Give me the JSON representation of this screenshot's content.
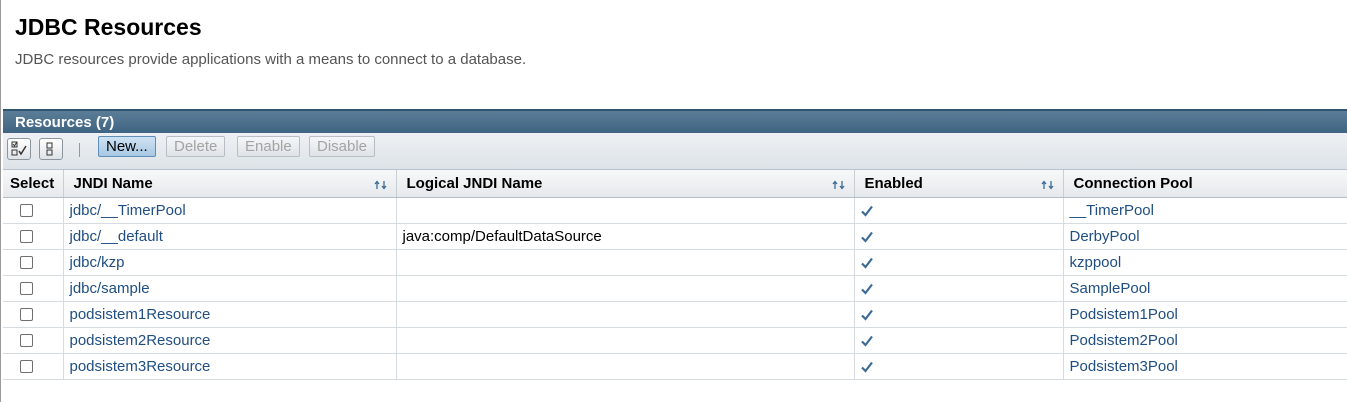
{
  "page": {
    "title": "JDBC Resources",
    "help_text": "JDBC resources provide applications with a means to connect to a database."
  },
  "table": {
    "title": "Resources (7)",
    "buttons": {
      "new": "New...",
      "delete": "Delete",
      "enable": "Enable",
      "disable": "Disable"
    },
    "columns": [
      "Select",
      "JNDI Name",
      "Logical JNDI Name",
      "Enabled",
      "Connection Pool"
    ],
    "rows": [
      {
        "jndi_name": "jdbc/__TimerPool",
        "logical_jndi_name": "",
        "enabled": true,
        "connection_pool": "__TimerPool"
      },
      {
        "jndi_name": "jdbc/__default",
        "logical_jndi_name": "java:comp/DefaultDataSource",
        "enabled": true,
        "connection_pool": "DerbyPool"
      },
      {
        "jndi_name": "jdbc/kzp",
        "logical_jndi_name": "",
        "enabled": true,
        "connection_pool": "kzppool"
      },
      {
        "jndi_name": "jdbc/sample",
        "logical_jndi_name": "",
        "enabled": true,
        "connection_pool": "SamplePool"
      },
      {
        "jndi_name": "podsistem1Resource",
        "logical_jndi_name": "",
        "enabled": true,
        "connection_pool": "Podsistem1Pool"
      },
      {
        "jndi_name": "podsistem2Resource",
        "logical_jndi_name": "",
        "enabled": true,
        "connection_pool": "Podsistem2Pool"
      },
      {
        "jndi_name": "podsistem3Resource",
        "logical_jndi_name": "",
        "enabled": true,
        "connection_pool": "Podsistem3Pool"
      }
    ]
  },
  "icons": {
    "select_all": "select-all-icon",
    "deselect_all": "deselect-all-icon",
    "sort": "sort-icon",
    "enabled": "checkmark-icon"
  },
  "colors": {
    "title_bar": "#4a6f8c",
    "link": "#1f4e82",
    "check": "#3c6b96"
  }
}
